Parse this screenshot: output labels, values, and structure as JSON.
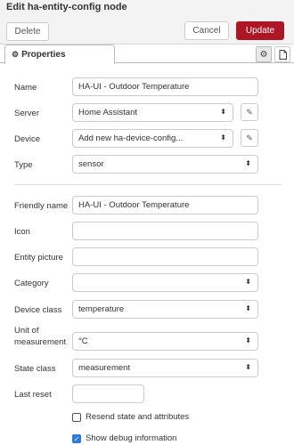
{
  "header": {
    "title": "Edit ha-entity-config node",
    "delete_label": "Delete",
    "cancel_label": "Cancel",
    "update_label": "Update",
    "accent_color": "#ad1625"
  },
  "tabs": {
    "properties_label": "Properties"
  },
  "fields": {
    "name": {
      "label": "Name",
      "value": "HA-UI - Outdoor Temperature"
    },
    "server": {
      "label": "Server",
      "value": "Home Assistant"
    },
    "device": {
      "label": "Device",
      "value": "Add new ha-device-config..."
    },
    "type": {
      "label": "Type",
      "value": "sensor"
    },
    "friendly_name": {
      "label": "Friendly name",
      "value": "HA-UI - Outdoor Temperature"
    },
    "icon": {
      "label": "Icon",
      "value": ""
    },
    "entity_picture": {
      "label": "Entity picture",
      "value": ""
    },
    "category": {
      "label": "Category",
      "value": ""
    },
    "device_class": {
      "label": "Device class",
      "value": "temperature"
    },
    "unit_of_measurement": {
      "label_line1": "Unit of",
      "label_line2": "measurement",
      "value": "°C"
    },
    "state_class": {
      "label": "State class",
      "value": "measurement"
    },
    "last_reset": {
      "label": "Last reset",
      "value": ""
    }
  },
  "checkboxes": {
    "resend": {
      "label": "Resend state and attributes",
      "checked": false
    },
    "debug": {
      "label": "Show debug information",
      "checked": true
    }
  }
}
